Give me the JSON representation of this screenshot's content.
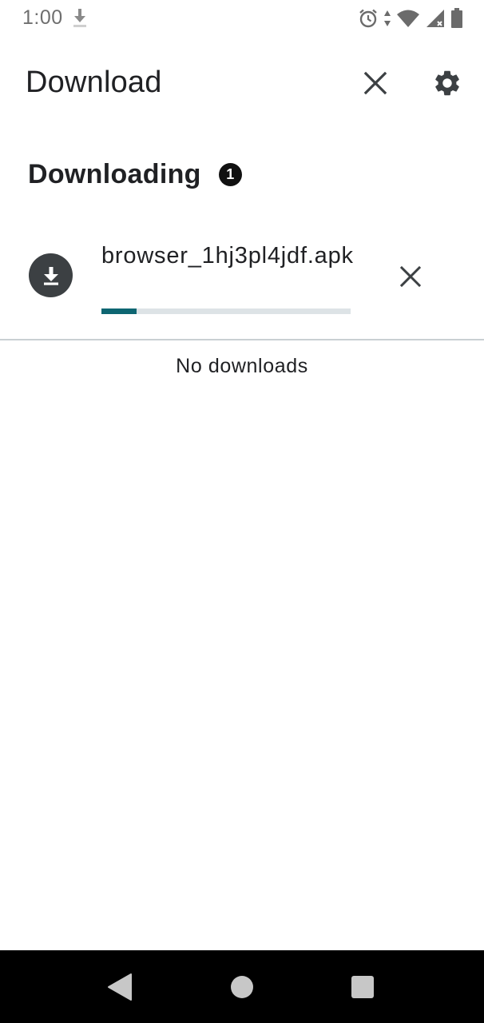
{
  "status_bar": {
    "time": "1:00",
    "icons": [
      "download-icon",
      "alarm-icon",
      "data-arrows-icon",
      "wifi-icon",
      "cellular-signal-icon",
      "battery-icon"
    ]
  },
  "app_bar": {
    "title": "Download",
    "close_icon": "close-icon",
    "settings_icon": "gear-icon"
  },
  "section": {
    "title": "Downloading",
    "count": "1"
  },
  "downloads": [
    {
      "filename": "browser_1hj3pl4jdf.apk",
      "progress": 0.14,
      "icon": "download-arrow-icon",
      "cancel_icon": "close-icon"
    }
  ],
  "empty_message": "No downloads",
  "nav_bar": {
    "icons": [
      "back-icon",
      "home-icon",
      "recents-icon"
    ]
  },
  "colors": {
    "progress_fill": "#0e6672",
    "progress_track": "#dde3e6",
    "avatar_bg": "#3c4043",
    "text": "#202124",
    "nav_bg": "#000000"
  }
}
